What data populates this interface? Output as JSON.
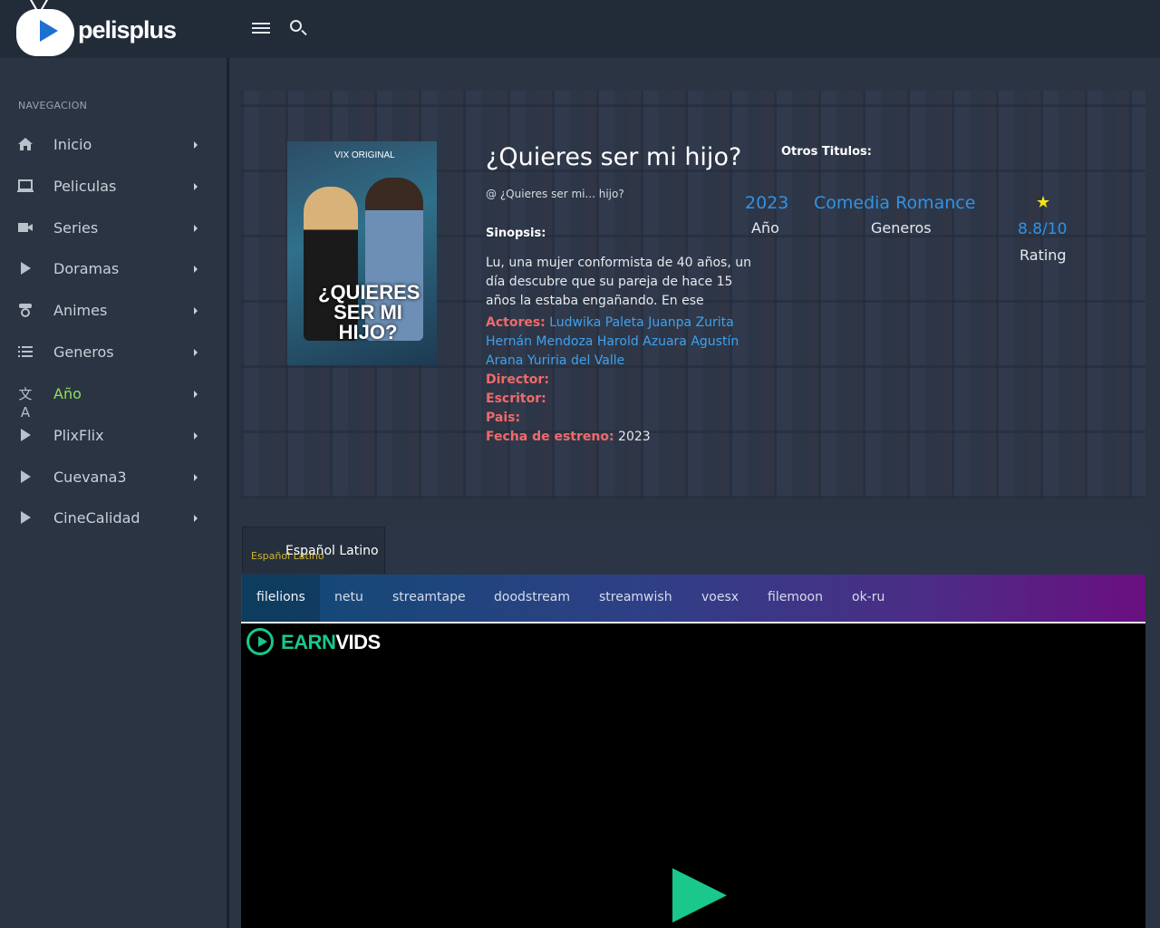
{
  "header": {
    "logo_text": "pelisplus",
    "menu_icon": "hamburger-menu-icon",
    "search_icon": "search-icon"
  },
  "sidebar": {
    "heading": "NAVEGACION",
    "items": [
      {
        "label": "Inicio",
        "icon": "home-icon"
      },
      {
        "label": "Peliculas",
        "icon": "laptop-icon"
      },
      {
        "label": "Series",
        "icon": "video-camera-icon"
      },
      {
        "label": "Doramas",
        "icon": "play-icon"
      },
      {
        "label": "Animes",
        "icon": "anime-icon"
      },
      {
        "label": "Generos",
        "icon": "list-icon"
      },
      {
        "label": "Año",
        "icon": "translate-icon",
        "active": true
      },
      {
        "label": "PlixFlix",
        "icon": "play-icon"
      },
      {
        "label": "Cuevana3",
        "icon": "play-icon"
      },
      {
        "label": "CineCalidad",
        "icon": "play-icon"
      }
    ]
  },
  "movie": {
    "poster_brand": "VIX ORIGINAL",
    "poster_title": "¿QUIERES SER MI HIJO?",
    "title": "¿Quieres ser mi hijo?",
    "original_title": "@ ¿Quieres ser mi... hijo?",
    "sinopsis_label": "Sinopsis:",
    "sinopsis": "Lu, una mujer conformista de 40 años, un día descubre que su pareja de hace 15 años la estaba engañando. En ese",
    "actores_label": "Actores:",
    "actores": "Ludwika Paleta Juanpa Zurita Hernán Mendoza Harold Azuara Agustín Arana Yuriria del Valle",
    "director_label": "Director:",
    "escritor_label": "Escritor:",
    "pais_label": "Pais:",
    "estreno_label": "Fecha de estreno:",
    "estreno": "2023",
    "otros_titulos_label": "Otros Titulos:",
    "year": "2023",
    "year_label": "Año",
    "genres": "Comedia Romance",
    "genres_label": "Generos",
    "rating": "8.8/10",
    "rating_label": "Rating"
  },
  "player": {
    "language_tab_small": "Español Latino",
    "language_tab": "Español Latino",
    "servers": [
      "filelions",
      "netu",
      "streamtape",
      "doodstream",
      "streamwish",
      "voesx",
      "filemoon",
      "ok-ru"
    ],
    "active_server": "filelions",
    "brand_part1": "EARN",
    "brand_part2": "VIDS"
  },
  "colors": {
    "accent_green": "#8fe05a",
    "link_blue": "#3ea2ef",
    "label_red": "#f06a6a",
    "star_yellow": "#f5e21a",
    "earnvids_green": "#19c88a"
  }
}
